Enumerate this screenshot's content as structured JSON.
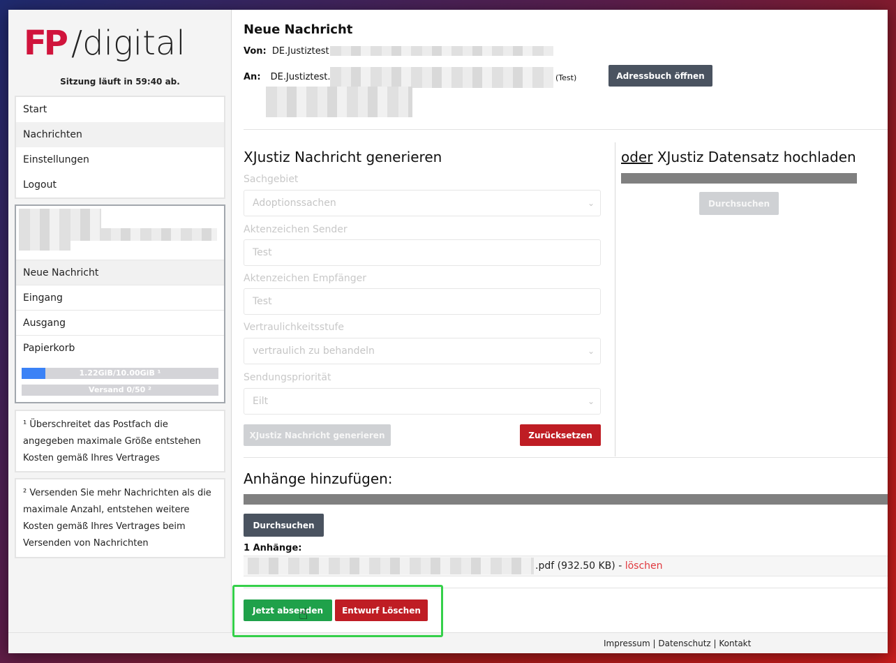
{
  "logo": {
    "mark": "FP",
    "text": "/digital"
  },
  "session": "Sitzung läuft in 59:40 ab.",
  "nav": [
    "Start",
    "Nachrichten",
    "Einstellungen",
    "Logout"
  ],
  "mailbox": {
    "items": [
      "Neue Nachricht",
      "Eingang",
      "Ausgang",
      "Papierkorb"
    ],
    "storage_label": "1.22GiB/10.00GiB ¹",
    "storage_fraction": 0.122,
    "send_label": "Versand 0/50 ²"
  },
  "notes": [
    "¹ Überschreitet das Postfach die angegeben maximale Größe entstehen Kosten gemäß Ihres Vertrages",
    "² Versenden Sie mehr Nachrichten als die maximale Anzahl, entstehen weitere Kosten gemäß Ihres Vertrages beim Versenden von Nachrichten"
  ],
  "message": {
    "title": "Neue Nachricht",
    "from_label": "Von:",
    "from_value": "DE.Justiztest.",
    "to_label": "An:",
    "to_value": "DE.Justiztest.6",
    "to_tag": "(Test)",
    "addressbook_button": "Adressbuch öffnen"
  },
  "generate": {
    "title": "XJustiz Nachricht generieren",
    "fields": {
      "sachgebiet_label": "Sachgebiet",
      "sachgebiet_value": "Adoptionssachen",
      "sender_label": "Aktenzeichen Sender",
      "sender_value": "Test",
      "empfaenger_label": "Aktenzeichen Empfänger",
      "empfaenger_value": "Test",
      "vertraulich_label": "Vertraulichkeitsstufe",
      "vertraulich_value": "vertraulich zu behandeln",
      "prioritaet_label": "Sendungspriorität",
      "prioritaet_value": "Eilt"
    },
    "generate_button": "XJustiz Nachricht generieren",
    "reset_button": "Zurücksetzen"
  },
  "upload": {
    "or_word": "oder",
    "title_rest": " XJustiz Datensatz hochladen",
    "browse_button": "Durchsuchen"
  },
  "attachments": {
    "title": "Anhänge hinzufügen:",
    "browse_button": "Durchsuchen",
    "count_label": "1 Anhänge:",
    "file_suffix": ".pdf (932.50 KB) - ",
    "delete_link": "löschen"
  },
  "actions": {
    "send_button": "Jetzt absenden",
    "delete_draft_button": "Entwurf Löschen"
  },
  "footer": [
    "Impressum",
    "Datenschutz",
    "Kontakt"
  ],
  "colors": {
    "brand_red": "#d0143c",
    "dark_button": "#4a5360",
    "danger": "#bf1d24",
    "success": "#1fa14a",
    "highlight": "#35d04a",
    "storage_bar": "#3b82f6"
  }
}
